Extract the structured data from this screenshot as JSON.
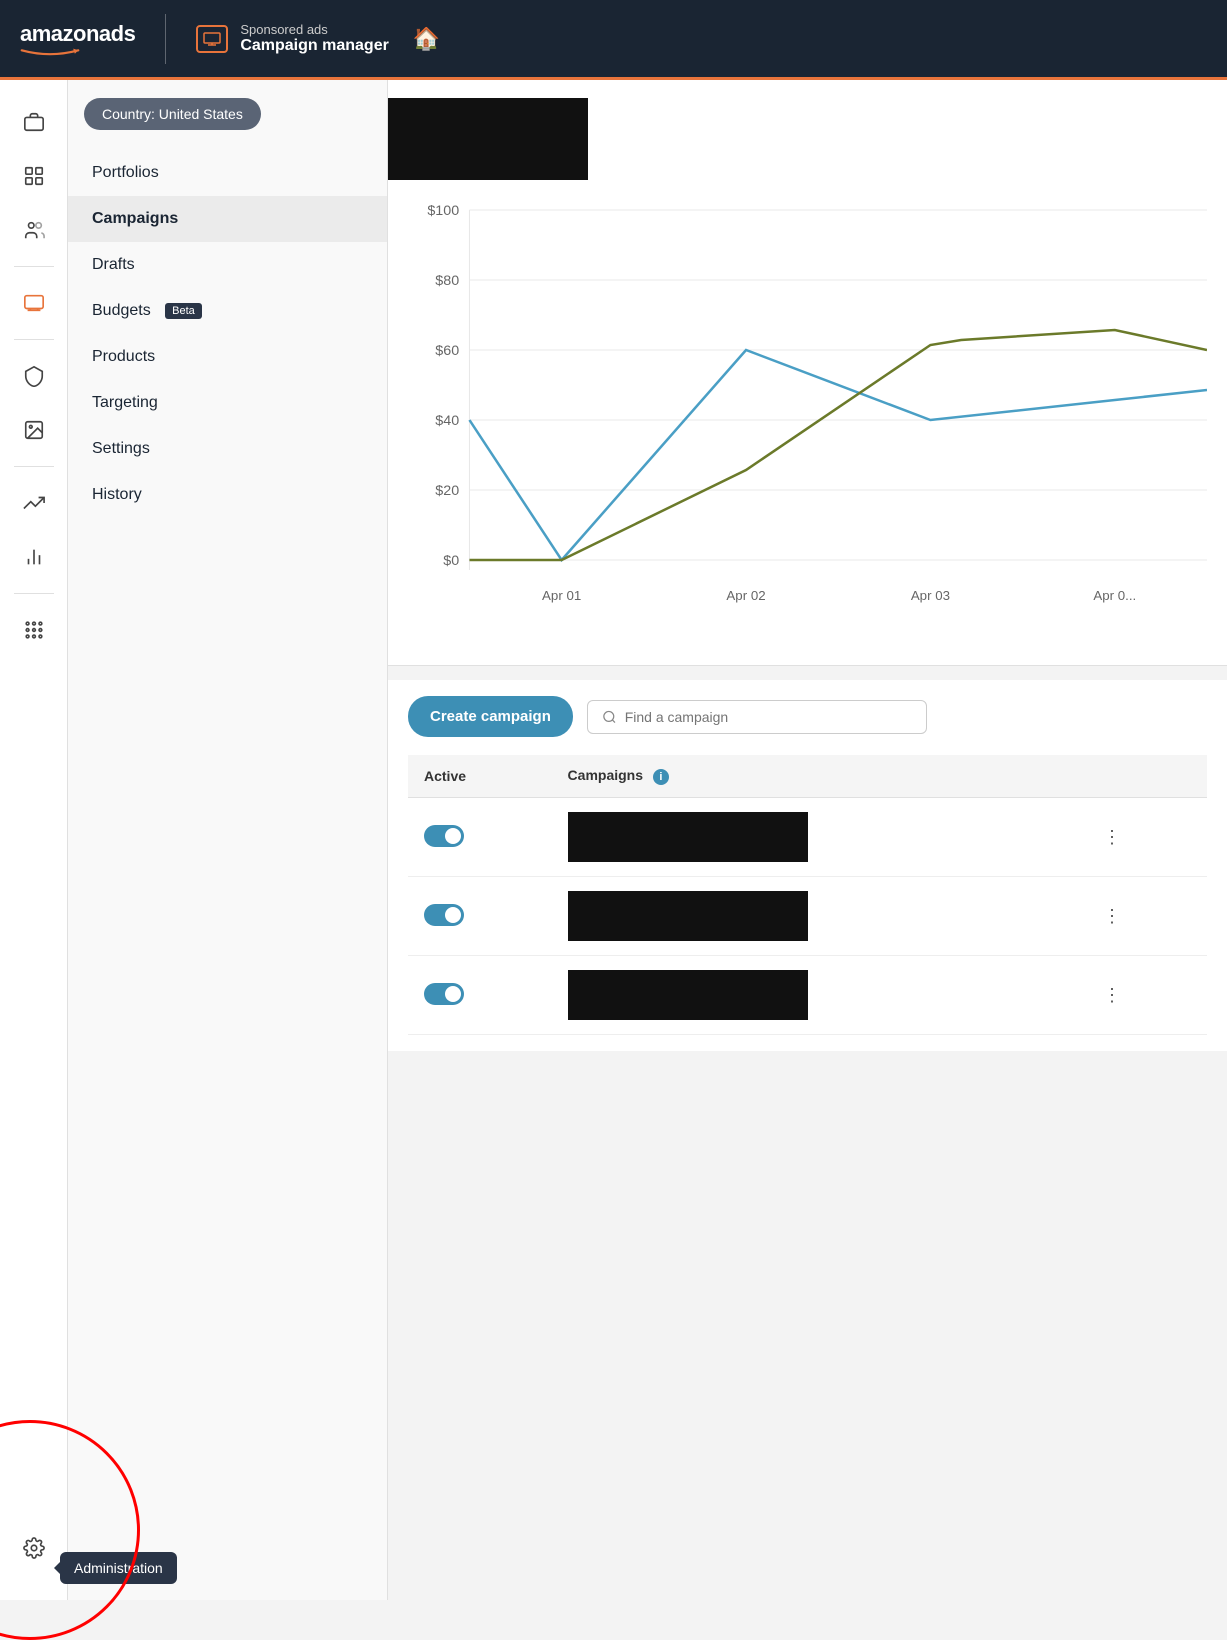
{
  "topNav": {
    "logoText": "amazonads",
    "productIconAlt": "sponsored-ads-icon",
    "sponsoredAdsLabel": "Sponsored ads",
    "campaignManagerLabel": "Campaign manager",
    "homeIconLabel": "home"
  },
  "iconSidebar": {
    "items": [
      {
        "name": "briefcase-icon",
        "symbol": "⊟",
        "active": false
      },
      {
        "name": "dashboard-icon",
        "symbol": "⊞",
        "active": false
      },
      {
        "name": "audience-icon",
        "symbol": "👥",
        "active": false
      },
      {
        "name": "sponsored-ads-icon",
        "symbol": "▣",
        "active": true
      },
      {
        "name": "shield-icon",
        "symbol": "🛡",
        "active": false
      },
      {
        "name": "media-icon",
        "symbol": "🖼",
        "active": false
      },
      {
        "name": "trending-icon",
        "symbol": "↗",
        "active": false
      },
      {
        "name": "chart-icon",
        "symbol": "📊",
        "active": false
      },
      {
        "name": "grid-icon",
        "symbol": "⋮⋮⋮",
        "active": false
      }
    ],
    "adminLabel": "Administration",
    "adminIconName": "gear-icon"
  },
  "subSidebar": {
    "countryLabel": "Country: United States",
    "navItems": [
      {
        "label": "Portfolios",
        "active": false,
        "beta": false
      },
      {
        "label": "Campaigns",
        "active": true,
        "beta": false
      },
      {
        "label": "Drafts",
        "active": false,
        "beta": false
      },
      {
        "label": "Budgets",
        "active": false,
        "beta": true
      },
      {
        "label": "Products",
        "active": false,
        "beta": false
      },
      {
        "label": "Targeting",
        "active": false,
        "beta": false
      },
      {
        "label": "Settings",
        "active": false,
        "beta": false
      },
      {
        "label": "History",
        "active": false,
        "beta": false
      }
    ],
    "betaLabel": "Beta"
  },
  "chart": {
    "yLabels": [
      "$100",
      "$80",
      "$60",
      "$40",
      "$20",
      "$0"
    ],
    "xLabels": [
      "Apr 01",
      "Apr 02",
      "Apr 03",
      "Apr 0..."
    ],
    "line1Color": "#4a9fc5",
    "line2Color": "#6b7a2a"
  },
  "campaignSection": {
    "createButtonLabel": "Create campaign",
    "searchPlaceholder": "Find a campaign",
    "tableHeaders": {
      "active": "Active",
      "campaigns": "Campaigns",
      "infoIcon": "i"
    },
    "rows": [
      {
        "toggle": true,
        "hasBlackBox": true
      },
      {
        "toggle": true,
        "hasBlackBox": true
      },
      {
        "toggle": true,
        "hasBlackBox": true
      }
    ]
  }
}
